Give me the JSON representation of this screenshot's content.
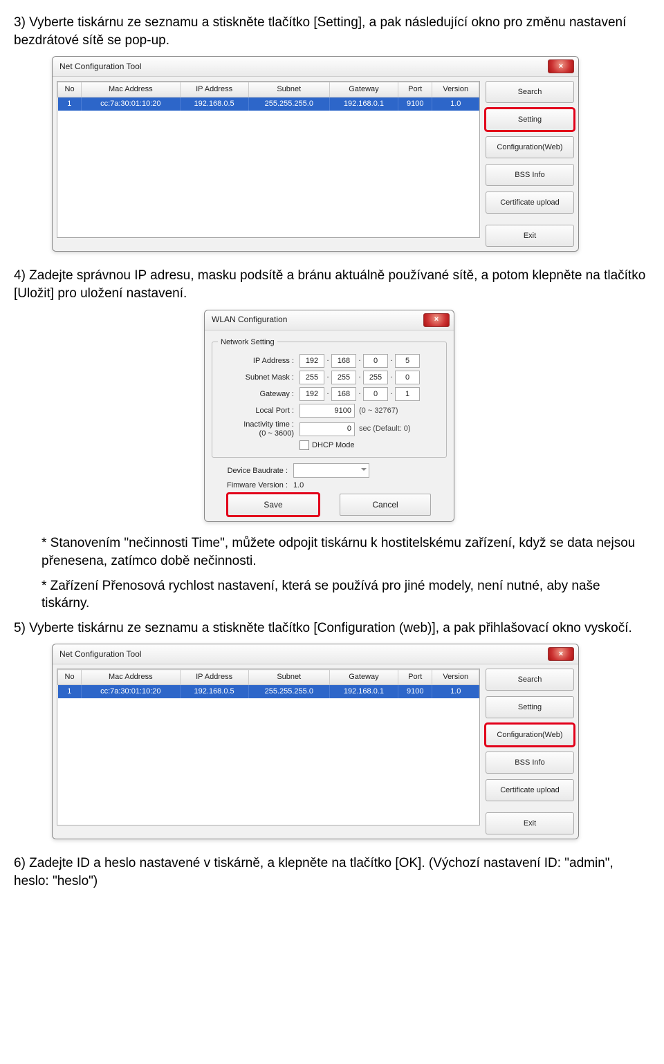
{
  "doc": {
    "p3": "3) Vyberte tiskárnu ze seznamu a stiskněte tlačítko [Setting], a pak následující okno pro změnu nastavení bezdrátové sítě se pop-up.",
    "p4": "4) Zadejte správnou IP adresu, masku podsítě a bránu aktuálně používané sítě, a potom klepněte na tlačítko [Uložit] pro uložení nastavení.",
    "note1": "* Stanovením \"nečinnosti Time\", můžete odpojit tiskárnu k hostitelskému zařízení, když se data nejsou přenesena, zatímco době nečinnosti.",
    "note2": "* Zařízení Přenosová rychlost nastavení, která se používá pro jiné modely, není nutné, aby naše tiskárny.",
    "p5": "5) Vyberte tiskárnu ze seznamu a stiskněte tlačítko [Configuration (web)], a pak přihlašovací okno vyskočí.",
    "p6": "6) Zadejte ID a heslo nastavené v tiskárně, a klepněte na tlačítko [OK]. (Výchozí nastavení ID: \"admin\", heslo: \"heslo\")"
  },
  "nct": {
    "title": "Net Configuration Tool",
    "headers": [
      "No",
      "Mac Address",
      "IP Address",
      "Subnet",
      "Gateway",
      "Port",
      "Version"
    ],
    "row": [
      "1",
      "cc:7a:30:01:10:20",
      "192.168.0.5",
      "255.255.255.0",
      "192.168.0.1",
      "9100",
      "1.0"
    ],
    "buttons": {
      "search": "Search",
      "setting": "Setting",
      "configweb": "Configuration(Web)",
      "bssinfo": "BSS Info",
      "certupload": "Certificate upload",
      "exit": "Exit"
    }
  },
  "wlan": {
    "title": "WLAN Configuration",
    "group": "Network Setting",
    "labels": {
      "ip": "IP Address :",
      "subnet": "Subnet Mask :",
      "gateway": "Gateway :",
      "localport": "Local Port :",
      "inact": "Inactivity time :",
      "inact_sub": "(0 ~ 3600)",
      "dhcp": "DHCP Mode",
      "baud": "Device Baudrate :",
      "fw": "Fimware Version :"
    },
    "values": {
      "ip": [
        "192",
        "168",
        "0",
        "5"
      ],
      "subnet": [
        "255",
        "255",
        "255",
        "0"
      ],
      "gateway": [
        "192",
        "168",
        "0",
        "1"
      ],
      "localport": "9100",
      "localport_hint": "(0 ~ 32767)",
      "inact": "0",
      "inact_hint": "sec (Default: 0)",
      "baud": "",
      "fw": "1.0"
    },
    "buttons": {
      "save": "Save",
      "cancel": "Cancel"
    }
  }
}
